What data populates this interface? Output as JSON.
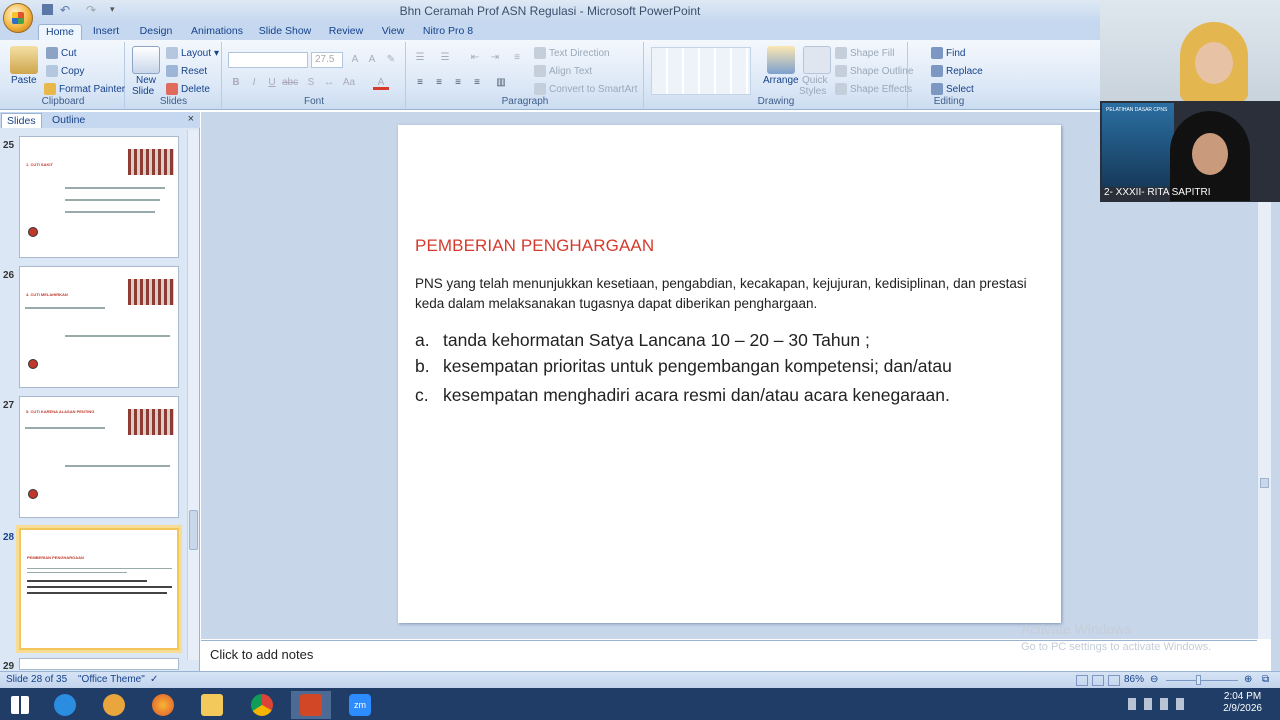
{
  "window": {
    "title": "Bhn Ceramah Prof ASN Regulasi - Microsoft PowerPoint"
  },
  "ribbon_tabs": [
    "Home",
    "Insert",
    "Design",
    "Animations",
    "Slide Show",
    "Review",
    "View",
    "Nitro Pro 8"
  ],
  "clipboard": {
    "paste": "Paste",
    "cut": "Cut",
    "copy": "Copy",
    "format_painter": "Format Painter",
    "label": "Clipboard"
  },
  "slides_group": {
    "new_slide": "New",
    "new_slide2": "Slide",
    "layout": "Layout",
    "reset": "Reset",
    "delete": "Delete",
    "label": "Slides"
  },
  "font_group": {
    "size": "27.5",
    "label": "Font"
  },
  "paragraph_group": {
    "text_direction": "Text Direction",
    "align_text": "Align Text",
    "convert": "Convert to SmartArt",
    "label": "Paragraph"
  },
  "drawing_group": {
    "arrange": "Arrange",
    "quick": "Quick",
    "styles": "Styles",
    "shape_fill": "Shape Fill",
    "shape_outline": "Shape Outline",
    "shape_effects": "Shape Effects",
    "label": "Drawing"
  },
  "editing_group": {
    "find": "Find",
    "replace": "Replace",
    "select": "Select",
    "label": "Editing"
  },
  "pane": {
    "slides_tab": "Slides",
    "outline_tab": "Outline",
    "close": "×"
  },
  "thumbnails": [
    {
      "num": "25",
      "title": "1. CUTI SAKIT"
    },
    {
      "num": "26",
      "title": "4. CUTI MELAHIRKAN"
    },
    {
      "num": "27",
      "title": "5. CUTI KARENA ALASAN PENTING"
    },
    {
      "num": "28",
      "title": "PEMBERIAN PENGHARGAAN"
    },
    {
      "num": "29",
      "title": ""
    }
  ],
  "slide": {
    "title": "PEMBERIAN PENGHARGAAN",
    "paragraph": "PNS yang telah menunjukkan kesetiaan, pengabdian, kecakapan, kejujuran, kedisiplinan, dan prestasi keda dalam melaksanakan tugasnya dapat diberikan penghargaan.",
    "items": [
      {
        "marker": "a.",
        "text": "tanda kehormatan Satya Lancana 10 – 20 – 30 Tahun  ;"
      },
      {
        "marker": "b.",
        "text": "kesempatan prioritas untuk pengembangan kompetensi; dan/atau"
      },
      {
        "marker": "c.",
        "text": "kesempatan menghadiri acara resmi dan/atau acara kenegaraan."
      }
    ]
  },
  "notes": {
    "placeholder": "Click to add notes"
  },
  "watermark": {
    "line1": "Activate Windows",
    "line2": "Go to PC settings to activate Windows."
  },
  "status": {
    "slide_info": "Slide 28 of 35",
    "theme": "\"Office Theme\"",
    "zoom": "86%"
  },
  "video": {
    "participant": "2- XXXII- RITA SAPITRI",
    "poster_text": "PELATIHAN DASAR CPNS"
  },
  "taskbar": {
    "time": "2:04 PM",
    "date": "2/9/2026"
  },
  "colors": {
    "accent": "#d63a2d",
    "ribbon": "#dbe7f6",
    "taskbar": "#1f3d66"
  }
}
